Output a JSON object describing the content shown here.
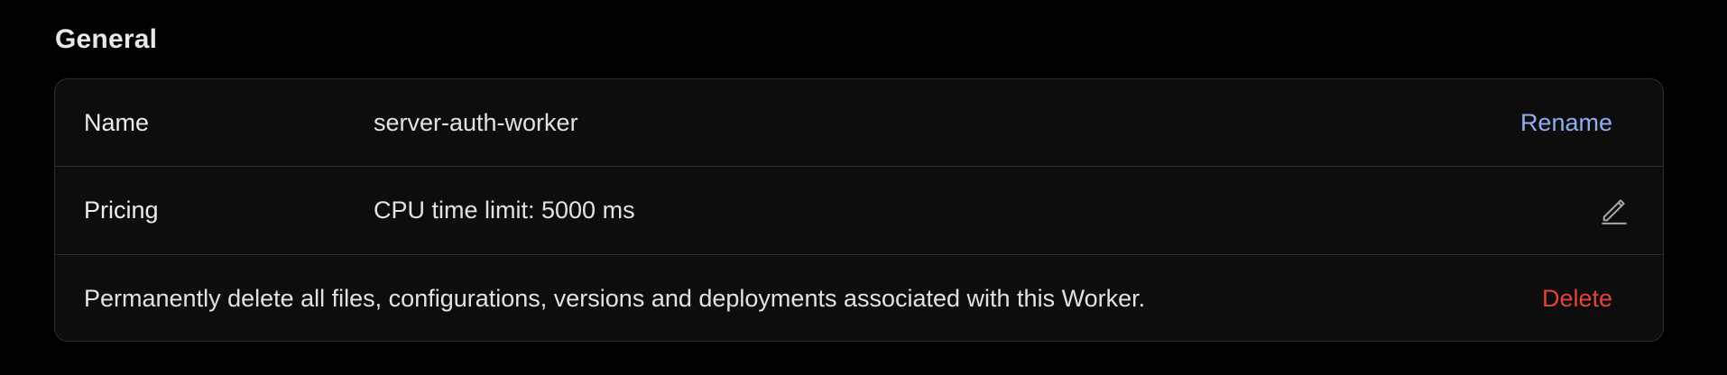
{
  "section": {
    "title": "General"
  },
  "rows": {
    "name": {
      "label": "Name",
      "value": "server-auth-worker",
      "action": "Rename"
    },
    "pricing": {
      "label": "Pricing",
      "value": "CPU time limit: 5000 ms",
      "icon": "edit-pencil-icon"
    },
    "delete": {
      "description": "Permanently delete all files, configurations, versions and deployments associated with this Worker.",
      "action": "Delete"
    }
  },
  "colors": {
    "rename_link": "#8eaef0",
    "delete_link": "#e0443a",
    "background": "#000000",
    "card": "#0d0d0d",
    "border": "#2e2e2e"
  }
}
